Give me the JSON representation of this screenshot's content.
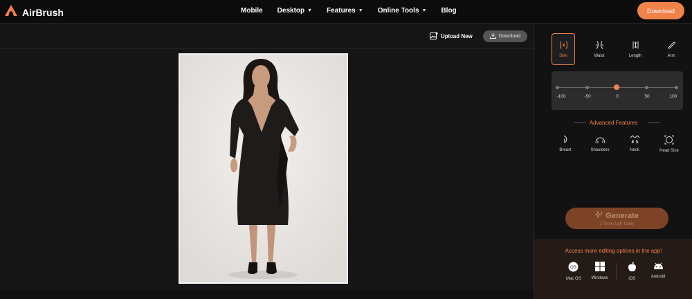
{
  "header": {
    "brand": "AirBrush",
    "nav": [
      "Mobile",
      "Desktop",
      "Features",
      "Online Tools",
      "Blog"
    ],
    "nav_has_dropdown": [
      false,
      true,
      true,
      true,
      false
    ],
    "download_label": "Download",
    "accent_color": "#f0824a"
  },
  "canvas": {
    "upload_label": "Upload New",
    "download_label": "Download"
  },
  "panel": {
    "tools": [
      {
        "label": "Slim",
        "icon": "slim-icon",
        "active": true
      },
      {
        "label": "Waist",
        "icon": "waist-icon",
        "active": false
      },
      {
        "label": "Length",
        "icon": "length-icon",
        "active": false
      },
      {
        "label": "Arm",
        "icon": "arm-icon",
        "active": false
      }
    ],
    "slider": {
      "ticks": [
        "-100",
        "-50",
        "0",
        "50",
        "100"
      ],
      "value": 0,
      "min": -100,
      "max": 100
    },
    "advanced_title": "Advanced Features",
    "advanced_tools": [
      {
        "label": "Breast",
        "icon": "breast-icon"
      },
      {
        "label": "Shoulders",
        "icon": "shoulders-icon"
      },
      {
        "label": "Neck",
        "icon": "neck-icon"
      },
      {
        "label": "Head Size",
        "icon": "head-size-icon"
      }
    ],
    "generate_label": "Generate",
    "generate_sub": "3 Times Left Today",
    "app_promo": "Access more editing options in the app!",
    "apps": [
      {
        "label": "Mac OS",
        "icon": "macos-icon"
      },
      {
        "label": "Windows",
        "icon": "windows-icon"
      },
      {
        "label": "iOS",
        "icon": "apple-icon"
      },
      {
        "label": "Android",
        "icon": "android-icon"
      }
    ]
  }
}
